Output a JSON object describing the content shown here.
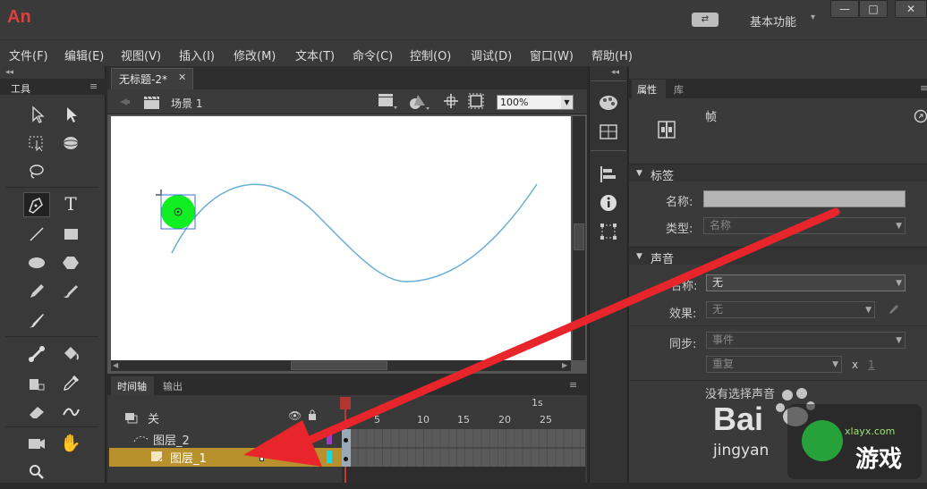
{
  "app": {
    "logo": "An",
    "workspace_label": "基本功能",
    "workspace_caret": "▾",
    "sync_icon": "⇄",
    "window_buttons": [
      "—",
      "□",
      "✕"
    ]
  },
  "menu": [
    "文件(F)",
    "编辑(E)",
    "视图(V)",
    "插入(I)",
    "修改(M)",
    "文本(T)",
    "命令(C)",
    "控制(O)",
    "调试(D)",
    "窗口(W)",
    "帮助(H)"
  ],
  "tools_panel": {
    "title": "工具"
  },
  "document": {
    "tab_title": "无标题-2*",
    "tab_close": "✕",
    "scene": "场景 1",
    "zoom": "100%"
  },
  "timeline": {
    "tabs": [
      "时间轴",
      "输出"
    ],
    "layers_header": "关",
    "ruler_marker": "1s",
    "ruler_numbers": [
      "5",
      "10",
      "15",
      "20",
      "25"
    ],
    "layers": [
      {
        "name": "图层_2"
      },
      {
        "name": "图层_1"
      }
    ]
  },
  "properties": {
    "tabs": [
      "属性",
      "库"
    ],
    "frame_label": "帧",
    "label_section": {
      "title": "标签",
      "name_label": "名称:",
      "type_label": "类型:",
      "type_value": "名称"
    },
    "sound_section": {
      "title": "声音",
      "name_label": "名称:",
      "name_value": "无",
      "effect_label": "效果:",
      "effect_value": "无",
      "sync_label": "同步:",
      "sync_value": "事件",
      "repeat_value": "重复",
      "x_label": "x",
      "count_value": "1",
      "status": "没有选择声音"
    }
  },
  "watermark": {
    "brand": "Bai",
    "sub": "jingyan",
    "site": "游戏",
    "site_small": "xlayx.com"
  },
  "colors": {
    "accent_red": "#e8252b",
    "layer_selected": "#b8912c",
    "circle": "#11ee22",
    "curve": "#6aaed6"
  }
}
